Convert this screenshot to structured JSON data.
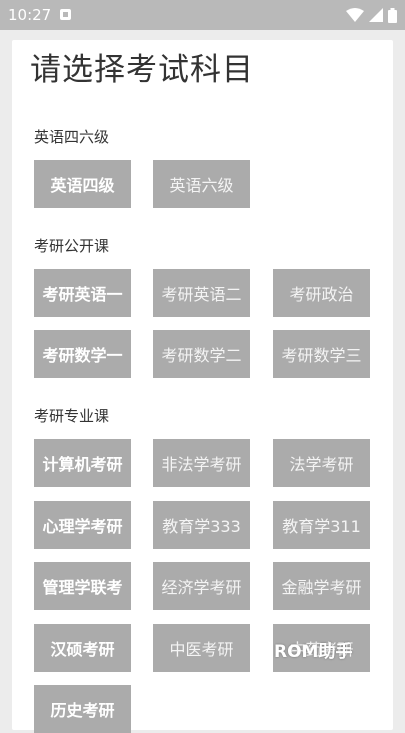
{
  "status_bar": {
    "time": "10:27",
    "icons": [
      "notification-icon",
      "wifi-icon",
      "signal-icon",
      "battery-icon"
    ]
  },
  "page_title": "请选择考试科目",
  "sections": [
    {
      "title": "英语四六级",
      "items": [
        "英语四级",
        "英语六级"
      ]
    },
    {
      "title": "考研公开课",
      "items": [
        "考研英语一",
        "考研英语二",
        "考研政治",
        "考研数学一",
        "考研数学二",
        "考研数学三"
      ]
    },
    {
      "title": "考研专业课",
      "items": [
        "计算机考研",
        "非法学考研",
        "法学考研",
        "心理学考研",
        "教育学333",
        "教育学311",
        "管理学联考",
        "经济学考研",
        "金融学考研",
        "汉硕考研",
        "中医考研",
        "中药考研",
        "历史考研"
      ]
    }
  ],
  "watermark": "ROM助手",
  "colors": {
    "status_bar": "#b9b9b9",
    "background": "#ececec",
    "card": "#ffffff",
    "chip": "#ababab",
    "chip_text": "#ffffff"
  }
}
